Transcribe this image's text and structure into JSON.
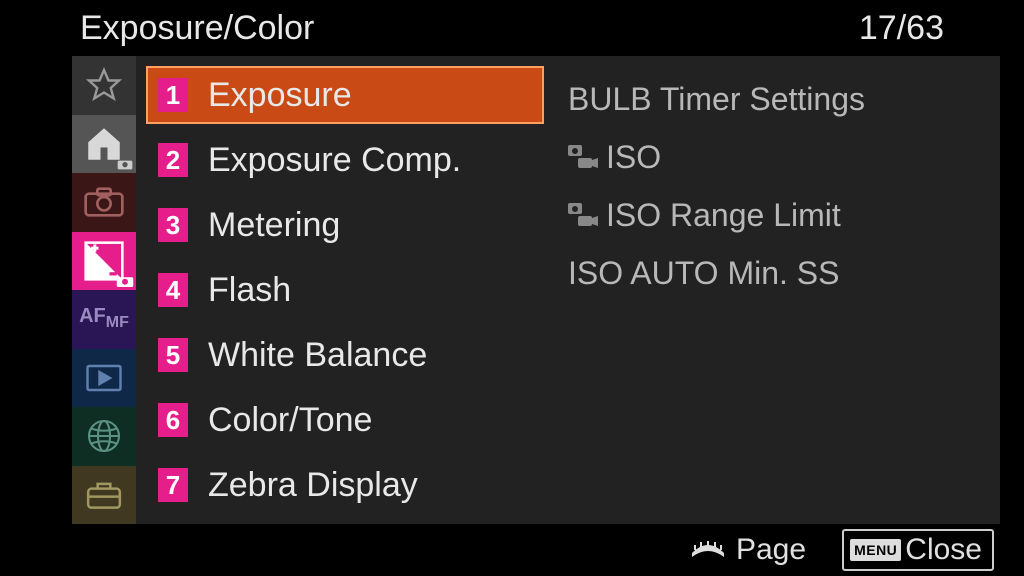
{
  "header": {
    "title": "Exposure/Color",
    "page_index": "17",
    "page_total": "63"
  },
  "menu": {
    "items": [
      {
        "num": "1",
        "label": "Exposure"
      },
      {
        "num": "2",
        "label": "Exposure Comp."
      },
      {
        "num": "3",
        "label": "Metering"
      },
      {
        "num": "4",
        "label": "Flash"
      },
      {
        "num": "5",
        "label": "White Balance"
      },
      {
        "num": "6",
        "label": "Color/Tone"
      },
      {
        "num": "7",
        "label": "Zebra Display"
      }
    ],
    "selected_index": 0
  },
  "details": {
    "items": [
      {
        "label": "BULB Timer Settings",
        "has_mode_icon": false
      },
      {
        "label": "ISO",
        "has_mode_icon": true
      },
      {
        "label": "ISO Range Limit",
        "has_mode_icon": true
      },
      {
        "label": "ISO AUTO Min. SS",
        "has_mode_icon": false
      }
    ]
  },
  "footer": {
    "page_label": "Page",
    "close_label": "Close",
    "menu_chip": "MENU"
  }
}
